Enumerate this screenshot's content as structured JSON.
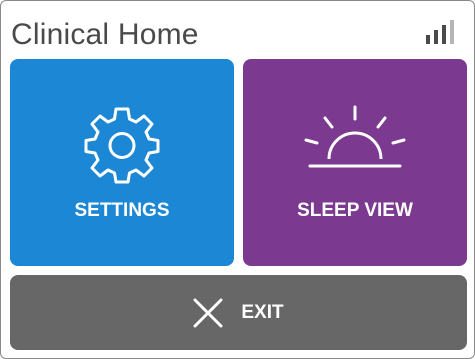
{
  "app": {
    "title": "Clinical Home"
  },
  "status": {
    "signal_icon": "signal-strength-icon",
    "signal_bars_active": 3,
    "signal_bars_total": 4
  },
  "tiles": {
    "settings": {
      "label": "SETTINGS",
      "icon": "gear-icon",
      "color": "#1c87d4"
    },
    "sleep_view": {
      "label": "SLEEP VIEW",
      "icon": "sunrise-icon",
      "color": "#7b3a8f"
    },
    "exit": {
      "label": "EXIT",
      "icon": "close-icon",
      "color": "#676767"
    }
  }
}
